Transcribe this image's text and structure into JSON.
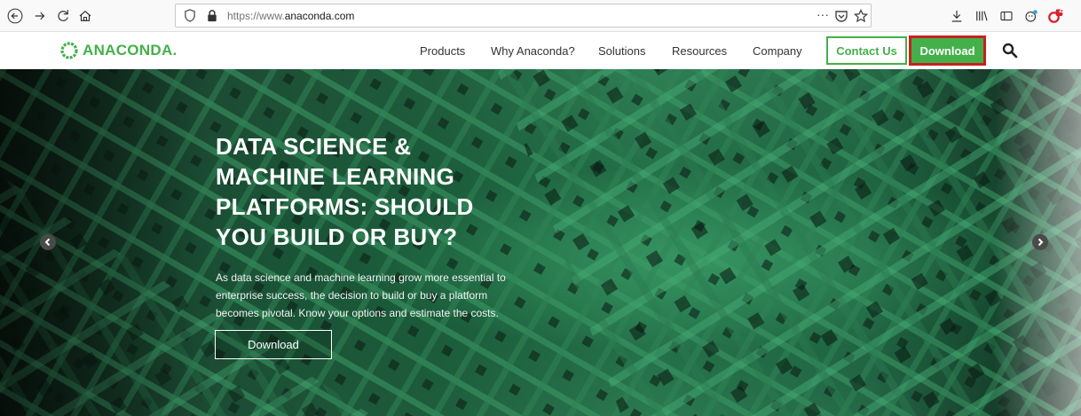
{
  "browser": {
    "url_prefix": "https://www.",
    "url_domain": "anaconda.com",
    "overflow_glyph": "···",
    "badge_count": "2"
  },
  "header": {
    "logo_text": "ANACONDA.",
    "nav": [
      "Products",
      "Why Anaconda?",
      "Solutions",
      "Resources",
      "Company"
    ],
    "contact_label": "Contact Us",
    "download_label": "Download"
  },
  "hero": {
    "title_lines": [
      "DATA SCIENCE &",
      "MACHINE LEARNING",
      "PLATFORMS: SHOULD",
      "YOU BUILD OR BUY?"
    ],
    "desc_lines": [
      "As data science and machine learning grow more essential to",
      "enterprise success, the decision to build or buy a platform",
      "becomes pivotal. Know your options and estimate the costs."
    ],
    "button_label": "Download"
  },
  "colors": {
    "brand_green": "#43b049",
    "highlight_red": "#c8201e"
  }
}
